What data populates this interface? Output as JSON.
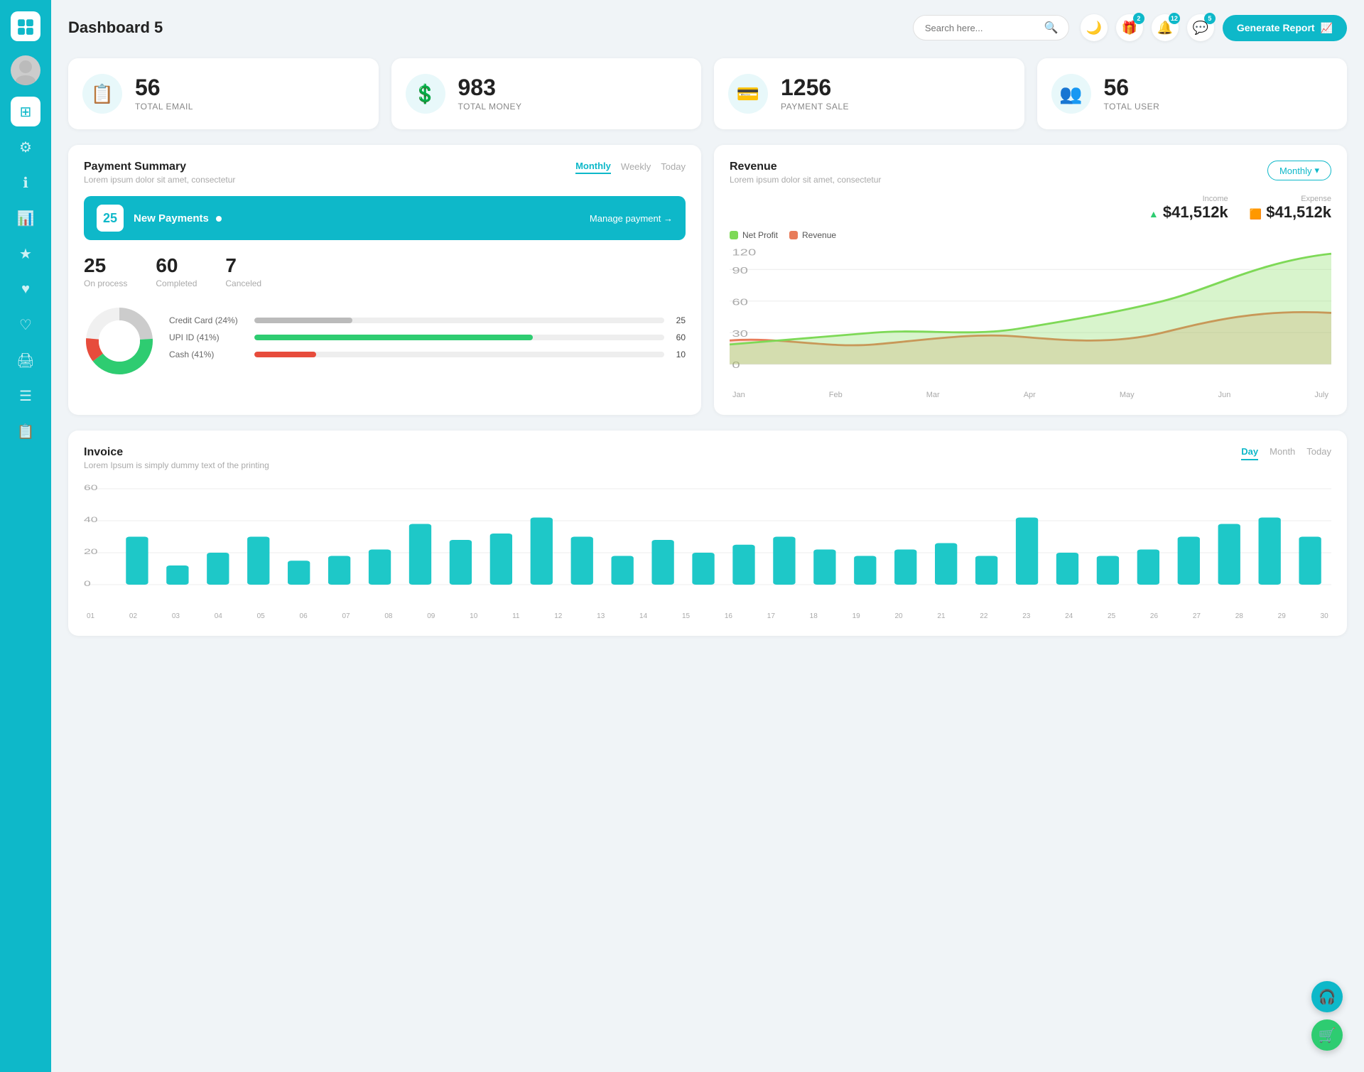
{
  "app": {
    "title": "Dashboard 5"
  },
  "header": {
    "search_placeholder": "Search here...",
    "badge1": "2",
    "badge2": "12",
    "badge3": "5",
    "generate_btn": "Generate Report"
  },
  "stats": [
    {
      "value": "56",
      "label": "TOTAL EMAIL",
      "icon": "📋"
    },
    {
      "value": "983",
      "label": "TOTAL MONEY",
      "icon": "💲"
    },
    {
      "value": "1256",
      "label": "PAYMENT SALE",
      "icon": "💳"
    },
    {
      "value": "56",
      "label": "TOTAL USER",
      "icon": "👥"
    }
  ],
  "payment_summary": {
    "title": "Payment Summary",
    "subtitle": "Lorem ipsum dolor sit amet, consectetur",
    "tabs": [
      "Monthly",
      "Weekly",
      "Today"
    ],
    "active_tab": "Monthly",
    "new_payments_count": "25",
    "new_payments_label": "New Payments",
    "manage_link": "Manage payment →",
    "stats": [
      {
        "value": "25",
        "label": "On process"
      },
      {
        "value": "60",
        "label": "Completed"
      },
      {
        "value": "7",
        "label": "Canceled"
      }
    ],
    "methods": [
      {
        "label": "Credit Card (24%)",
        "color": "#999",
        "pct": 24,
        "count": "25"
      },
      {
        "label": "UPI ID (41%)",
        "color": "#2ecc71",
        "pct": 41,
        "count": "60"
      },
      {
        "label": "Cash (41%)",
        "color": "#e74c3c",
        "pct": 10,
        "count": "10"
      }
    ]
  },
  "revenue": {
    "title": "Revenue",
    "subtitle": "Lorem ipsum dolor sit amet, consectetur",
    "monthly_btn": "Monthly",
    "income_title": "Income",
    "income_val": "$41,512k",
    "expense_title": "Expense",
    "expense_val": "$41,512k",
    "legend": [
      {
        "label": "Net Profit",
        "color": "#7ed957"
      },
      {
        "label": "Revenue",
        "color": "#e87c5a"
      }
    ],
    "x_labels": [
      "Jan",
      "Feb",
      "Mar",
      "Apr",
      "May",
      "Jun",
      "July"
    ]
  },
  "invoice": {
    "title": "Invoice",
    "subtitle": "Lorem Ipsum is simply dummy text of the printing",
    "tabs": [
      "Day",
      "Month",
      "Today"
    ],
    "active_tab": "Day",
    "y_labels": [
      "0",
      "20",
      "40",
      "60"
    ],
    "x_labels": [
      "01",
      "02",
      "03",
      "04",
      "05",
      "06",
      "07",
      "08",
      "09",
      "10",
      "11",
      "12",
      "13",
      "14",
      "15",
      "16",
      "17",
      "18",
      "19",
      "20",
      "21",
      "22",
      "23",
      "24",
      "25",
      "26",
      "27",
      "28",
      "29",
      "30"
    ],
    "bars": [
      30,
      12,
      20,
      30,
      15,
      18,
      22,
      38,
      28,
      32,
      42,
      30,
      18,
      28,
      20,
      25,
      30,
      22,
      18,
      22,
      26,
      18,
      42,
      20,
      18,
      22,
      30,
      38,
      42,
      30
    ]
  },
  "sidebar": {
    "items": [
      {
        "icon": "⊞",
        "label": "dashboard",
        "active": true
      },
      {
        "icon": "⚙",
        "label": "settings",
        "active": false
      },
      {
        "icon": "ℹ",
        "label": "info",
        "active": false
      },
      {
        "icon": "📊",
        "label": "analytics",
        "active": false
      },
      {
        "icon": "★",
        "label": "favorites",
        "active": false
      },
      {
        "icon": "♥",
        "label": "likes",
        "active": false
      },
      {
        "icon": "♥",
        "label": "saved",
        "active": false
      },
      {
        "icon": "🖨",
        "label": "print",
        "active": false
      },
      {
        "icon": "☰",
        "label": "menu",
        "active": false
      },
      {
        "icon": "📋",
        "label": "reports",
        "active": false
      }
    ]
  }
}
